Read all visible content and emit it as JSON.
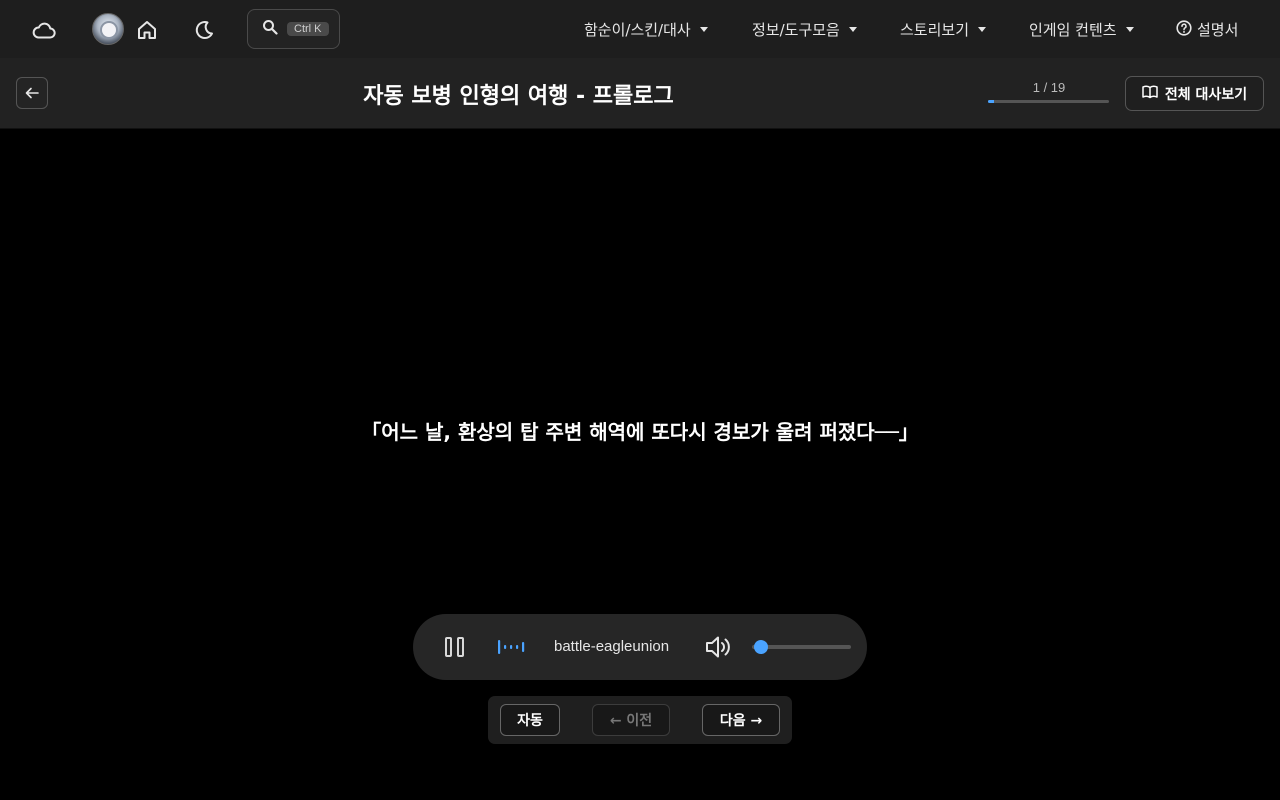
{
  "nav": {
    "icons": [
      "cloud-icon",
      "avatar",
      "home-icon",
      "moon-icon",
      "search-icon"
    ],
    "search_shortcut": "Ctrl K",
    "menus": [
      {
        "label": "함순이/스킨/대사"
      },
      {
        "label": "정보/도구모음"
      },
      {
        "label": "스토리보기"
      },
      {
        "label": "인게임 컨텐츠"
      }
    ],
    "help_label": "설명서"
  },
  "header": {
    "title": "자동 보병 인형의 여행 - 프롤로그",
    "progress_text": "1 / 19",
    "progress_current": 1,
    "progress_total": 19,
    "full_dialogue_label": "전체 대사보기"
  },
  "story": {
    "dialogue": "「어느 날, 환상의 탑 주변 해역에 또다시 경보가 울려 퍼졌다──」"
  },
  "player": {
    "track_name": "battle-eagleunion",
    "volume": 0.02,
    "state": "playing"
  },
  "controls": {
    "auto_label": "자동",
    "prev_label": "← 이전",
    "next_label": "다음 →"
  },
  "colors": {
    "accent": "#4aa3ff",
    "nav_bg": "#1e1e1e",
    "title_bg": "#222222",
    "stage_bg": "#000000"
  }
}
